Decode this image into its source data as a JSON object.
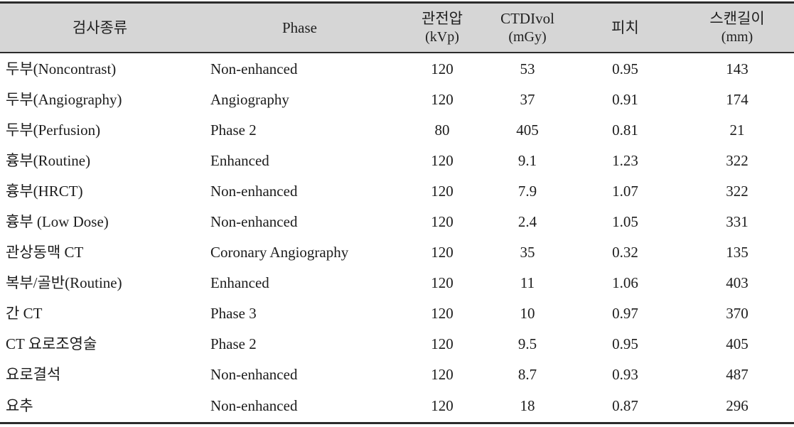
{
  "table": {
    "columns": [
      {
        "id": "exam",
        "label": "검사종류",
        "unit": "",
        "align": "left"
      },
      {
        "id": "phase",
        "label": "Phase",
        "unit": "",
        "align": "left"
      },
      {
        "id": "kvp",
        "label": "관전압",
        "unit": "(kVp)",
        "align": "center"
      },
      {
        "id": "ctdi",
        "label": "CTDIvol",
        "unit": "(mGy)",
        "align": "center"
      },
      {
        "id": "pitch",
        "label": "피치",
        "unit": "",
        "align": "center"
      },
      {
        "id": "scan",
        "label": "스캔길이",
        "unit": "(mm)",
        "align": "center"
      }
    ],
    "rows": [
      {
        "exam": "두부(Noncontrast)",
        "phase": "Non-enhanced",
        "kvp": "120",
        "ctdi": "53",
        "pitch": "0.95",
        "scan": "143"
      },
      {
        "exam": "두부(Angiography)",
        "phase": "Angiography",
        "kvp": "120",
        "ctdi": "37",
        "pitch": "0.91",
        "scan": "174"
      },
      {
        "exam": "두부(Perfusion)",
        "phase": "Phase 2",
        "kvp": "80",
        "ctdi": "405",
        "pitch": "0.81",
        "scan": "21"
      },
      {
        "exam": "흉부(Routine)",
        "phase": "Enhanced",
        "kvp": "120",
        "ctdi": "9.1",
        "pitch": "1.23",
        "scan": "322"
      },
      {
        "exam": "흉부(HRCT)",
        "phase": "Non-enhanced",
        "kvp": "120",
        "ctdi": "7.9",
        "pitch": "1.07",
        "scan": "322"
      },
      {
        "exam": "흉부 (Low Dose)",
        "phase": "Non-enhanced",
        "kvp": "120",
        "ctdi": "2.4",
        "pitch": "1.05",
        "scan": "331"
      },
      {
        "exam": "관상동맥 CT",
        "phase": "Coronary Angiography",
        "kvp": "120",
        "ctdi": "35",
        "pitch": "0.32",
        "scan": "135"
      },
      {
        "exam": "복부/골반(Routine)",
        "phase": "Enhanced",
        "kvp": "120",
        "ctdi": "11",
        "pitch": "1.06",
        "scan": "403"
      },
      {
        "exam": "간 CT",
        "phase": "Phase 3",
        "kvp": "120",
        "ctdi": "10",
        "pitch": "0.97",
        "scan": "370"
      },
      {
        "exam": "CT 요로조영술",
        "phase": "Phase 2",
        "kvp": "120",
        "ctdi": "9.5",
        "pitch": "0.95",
        "scan": "405"
      },
      {
        "exam": "요로결석",
        "phase": "Non-enhanced",
        "kvp": "120",
        "ctdi": "8.7",
        "pitch": "0.93",
        "scan": "487"
      },
      {
        "exam": "요추",
        "phase": "Non-enhanced",
        "kvp": "120",
        "ctdi": "18",
        "pitch": "0.87",
        "scan": "296"
      }
    ]
  },
  "style": {
    "header_background": "#d6d6d6",
    "rule_color": "#2b2b2b",
    "text_color": "#1c1c1c",
    "body_background": "#ffffff"
  }
}
